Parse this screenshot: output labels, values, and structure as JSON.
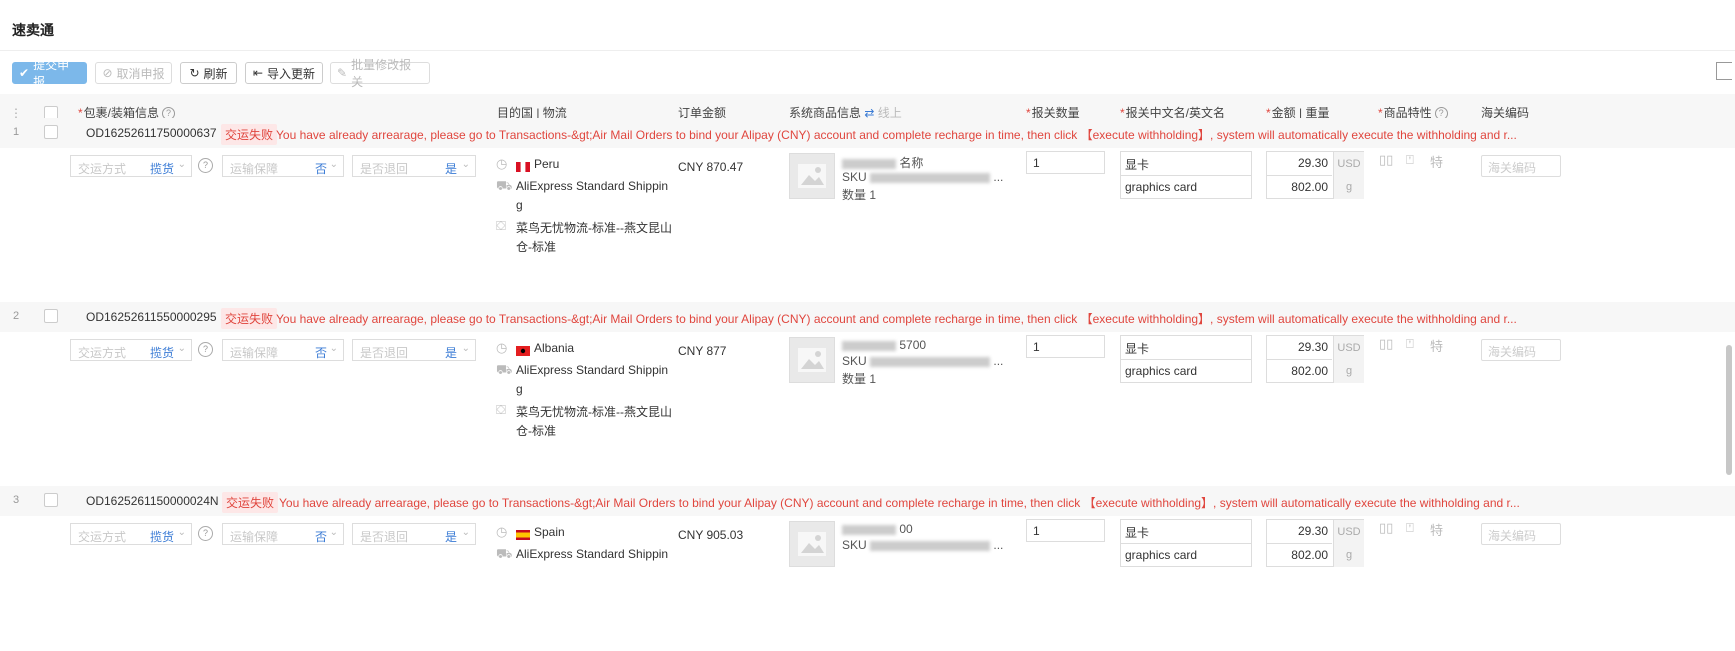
{
  "app": {
    "title": "速卖通"
  },
  "toolbar": {
    "submit": "提交申报",
    "cancel": "取消申报",
    "refresh": "刷新",
    "import": "导入更新",
    "batch_edit": "批量修改报关"
  },
  "table": {
    "headers": {
      "package": "包裹/装箱信息",
      "destination": "目的国 | 物流",
      "amount": "订单金额",
      "goods": "系统商品信息",
      "goods_link": "线上",
      "qty": "报关数量",
      "names": "报关中文名/英文名",
      "money_weight": "金额 | 重量",
      "feature": "商品特性",
      "hs": "海关编码"
    },
    "placeholders": {
      "transport": "交运方式",
      "insurance": "运输保障",
      "returns": "是否退回",
      "hs": "海关编码"
    },
    "rows": [
      {
        "num": "1",
        "order_no": "OD16252611750000637",
        "status": "交运失败",
        "message": "You have already arrearage, please go to Transactions-&gt;Air Mail Orders to bind your Alipay (CNY) account and complete recharge in time, then click 【execute withholding】, system will automatically execute the withholding and r...",
        "transport_value": "揽货",
        "insurance_value": "否",
        "returns_value": "是",
        "country": "Peru",
        "shipping_line1": "AliExpress Standard Shippin",
        "shipping_line2": "g",
        "warehouse_line1": "菜鸟无忧物流-标准--燕文昆山",
        "warehouse_line2": "仓-标准",
        "amount": "CNY 870.47",
        "goods_name": "名称",
        "goods_sku": "SKU",
        "goods_qty": "数量 1",
        "qty": "1",
        "cn_name": "显卡",
        "en_name": "graphics card",
        "price": "29.30",
        "currency": "USD",
        "weight": "802.00",
        "weight_unit": "g"
      },
      {
        "num": "2",
        "order_no": "OD16252611550000295",
        "status": "交运失败",
        "message": "You have already arrearage, please go to Transactions-&gt;Air Mail Orders to bind your Alipay (CNY) account and complete recharge in time, then click 【execute withholding】, system will automatically execute the withholding and r...",
        "transport_value": "揽货",
        "insurance_value": "否",
        "returns_value": "是",
        "country": "Albania",
        "shipping_line1": "AliExpress Standard Shippin",
        "shipping_line2": "g",
        "warehouse_line1": "菜鸟无忧物流-标准--燕文昆山",
        "warehouse_line2": "仓-标准",
        "amount": "CNY 877",
        "goods_name": "5700",
        "goods_sku": "SKU",
        "goods_qty": "数量 1",
        "qty": "1",
        "cn_name": "显卡",
        "en_name": "graphics card",
        "price": "29.30",
        "currency": "USD",
        "weight": "802.00",
        "weight_unit": "g"
      },
      {
        "num": "3",
        "order_no": "OD1625261150000024N",
        "status": "交运失败",
        "message": "You have already arrearage, please go to Transactions-&gt;Air Mail Orders to bind your Alipay (CNY) account and complete recharge in time, then click 【execute withholding】, system will automatically execute the withholding and r...",
        "transport_value": "揽货",
        "insurance_value": "否",
        "returns_value": "是",
        "country": "Spain",
        "shipping_line1": "AliExpress Standard Shippin",
        "amount": "CNY 905.03",
        "goods_name": "00",
        "goods_sku": "SKU",
        "qty": "1",
        "cn_name": "显卡",
        "en_name": "graphics card",
        "price": "29.30",
        "currency": "USD",
        "weight": "802.00",
        "weight_unit": "g"
      }
    ]
  },
  "colors": {
    "accent": "#3a7bd5",
    "danger": "#e0463e",
    "primary_button": "#7cb8ea"
  },
  "icons": [
    "check-icon",
    "cancel-icon",
    "refresh-icon",
    "import-icon",
    "edit-icon",
    "question-icon",
    "clock-icon",
    "truck-icon",
    "warehouse-icon",
    "image-placeholder-icon",
    "swap-icon",
    "battery-icon",
    "liquid-icon",
    "special-icon",
    "columns-icon"
  ]
}
